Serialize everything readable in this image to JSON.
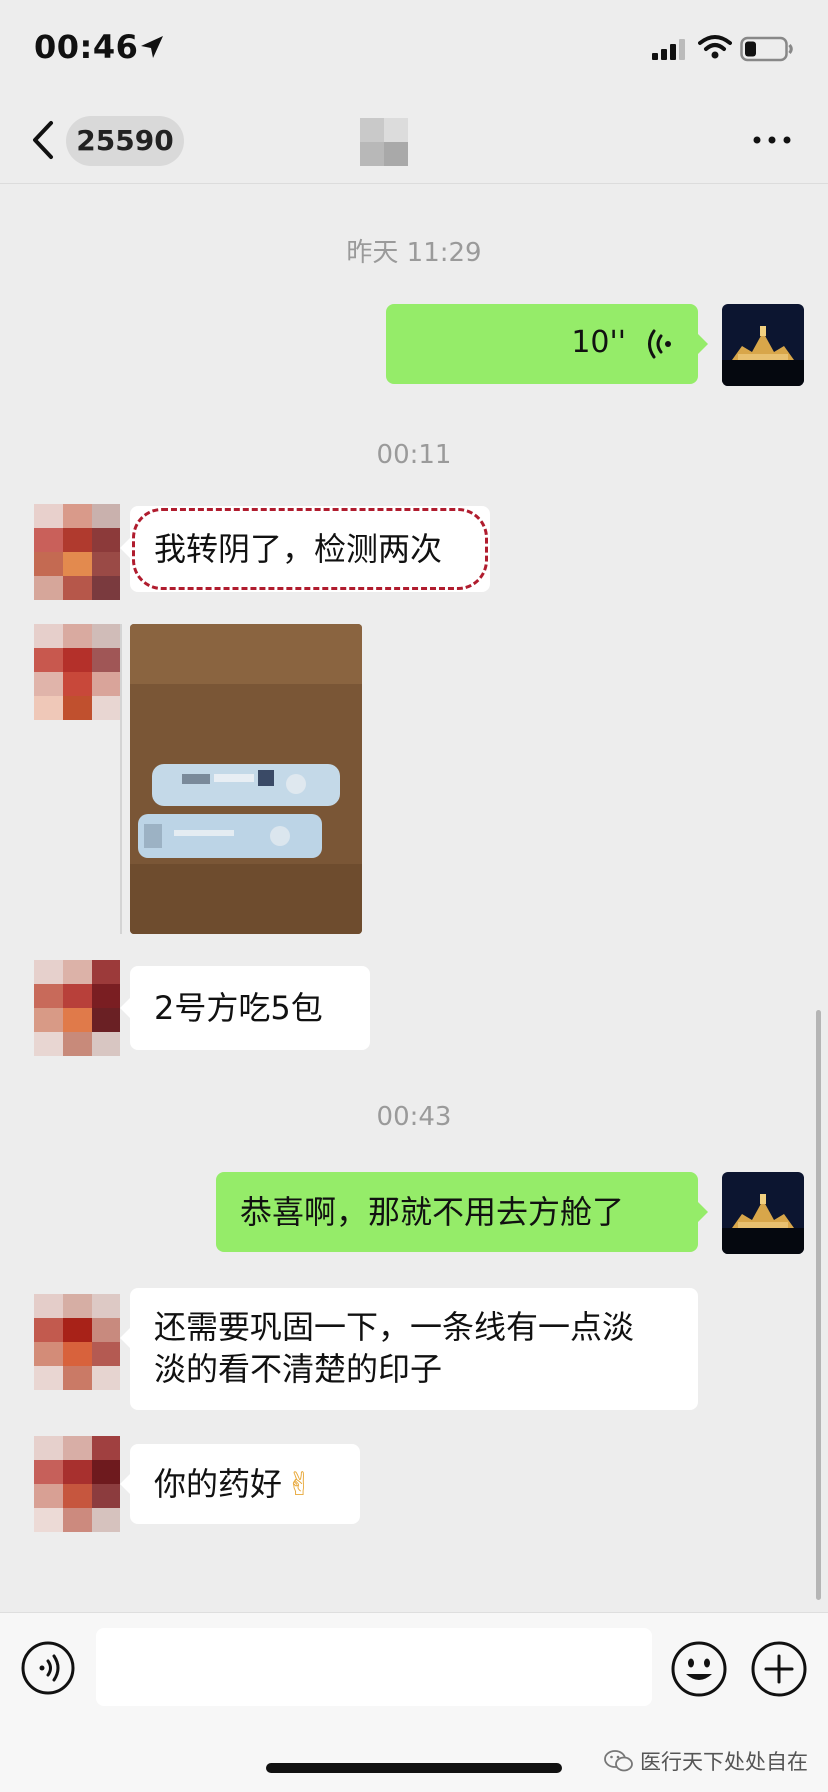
{
  "status_bar": {
    "time": "00:46"
  },
  "nav": {
    "unread_count": "25590"
  },
  "messages": [
    {
      "timestamp": "昨天 11:29"
    },
    {
      "voice_duration": "10''"
    },
    {
      "timestamp": "00:11"
    },
    {
      "text": "我转阴了，检测两次"
    },
    {
      "text": "2号方吃5包"
    },
    {
      "timestamp": "00:43"
    },
    {
      "text": "恭喜啊，那就不用去方舱了"
    },
    {
      "text_line1": "还需要巩固一下，一条线有一点淡",
      "text_line2": "淡的看不清楚的印子"
    },
    {
      "text": "你的药好",
      "emoji": "✌"
    }
  ],
  "watermark": {
    "text": "医行天下处处自在"
  },
  "colors": {
    "bubble_right": "#95ec69",
    "bubble_left": "#ffffff",
    "background": "#ededed",
    "highlight": "#b01c2e"
  }
}
